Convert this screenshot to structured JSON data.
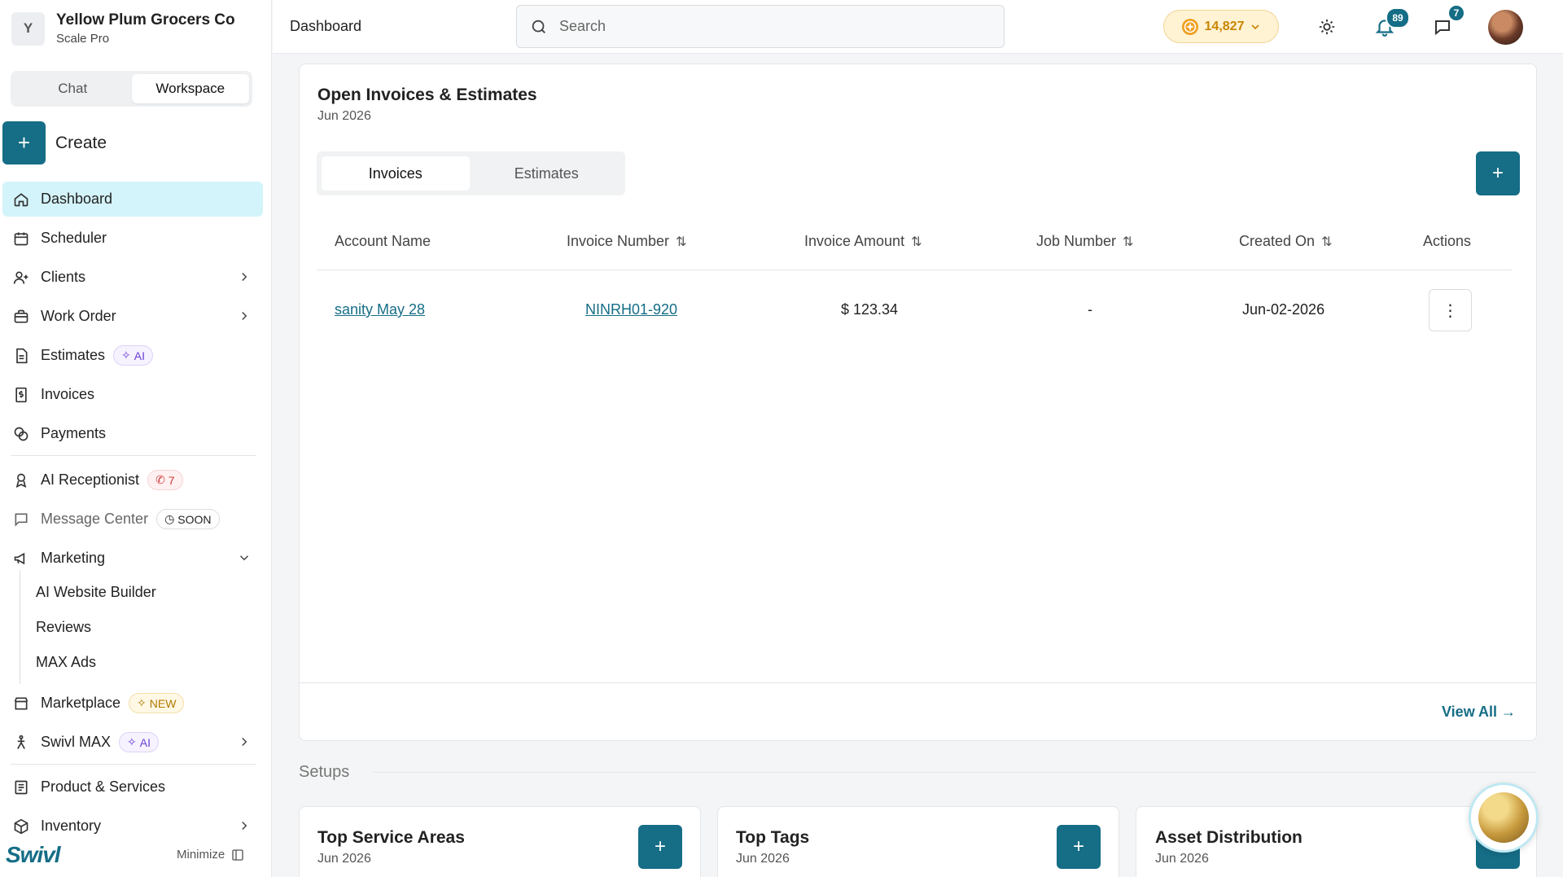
{
  "org": {
    "initial": "Y",
    "name": "Yellow Plum Grocers Co",
    "plan": "Scale Pro"
  },
  "mode": {
    "chat": "Chat",
    "workspace": "Workspace"
  },
  "create_label": "Create",
  "nav": {
    "dashboard": "Dashboard",
    "scheduler": "Scheduler",
    "clients": "Clients",
    "work_order": "Work Order",
    "estimates": "Estimates",
    "estimates_badge": "AI",
    "invoices": "Invoices",
    "payments": "Payments",
    "ai_receptionist": "AI Receptionist",
    "ai_receptionist_count": "7",
    "message_center": "Message Center",
    "message_center_badge": "SOON",
    "marketing": "Marketing",
    "marketing_sub": [
      "AI Website Builder",
      "Reviews",
      "MAX Ads"
    ],
    "marketplace": "Marketplace",
    "marketplace_badge": "NEW",
    "swivl_max": "Swivl MAX",
    "swivl_max_badge": "AI",
    "product_services": "Product & Services",
    "inventory": "Inventory"
  },
  "brand": "Swivl",
  "minimize_label": "Minimize",
  "topbar": {
    "title": "Dashboard",
    "search_placeholder": "Search",
    "coins": "14,827",
    "notifications_count": "89",
    "messages_count": "7"
  },
  "invoices_card": {
    "title": "Open Invoices & Estimates",
    "subtitle": "Jun 2026",
    "tabs": [
      "Invoices",
      "Estimates"
    ],
    "columns": [
      "Account Name",
      "Invoice Number",
      "Invoice Amount",
      "Job Number",
      "Created On",
      "Actions"
    ],
    "rows": [
      {
        "account": "sanity May 28",
        "invoice_number": "NINRH01-920",
        "amount": "$ 123.34",
        "job_number": "-",
        "created_on": "Jun-02-2026"
      }
    ],
    "view_all": "View All →"
  },
  "setups": {
    "label": "Setups",
    "cards": [
      {
        "title": "Top Service Areas",
        "subtitle": "Jun 2026"
      },
      {
        "title": "Top Tags",
        "subtitle": "Jun 2026"
      },
      {
        "title": "Asset Distribution",
        "subtitle": "Jun 2026"
      }
    ]
  },
  "colors": {
    "accent": "#156d86",
    "active_nav": "#d4f4fb",
    "coin": "#c98600"
  }
}
